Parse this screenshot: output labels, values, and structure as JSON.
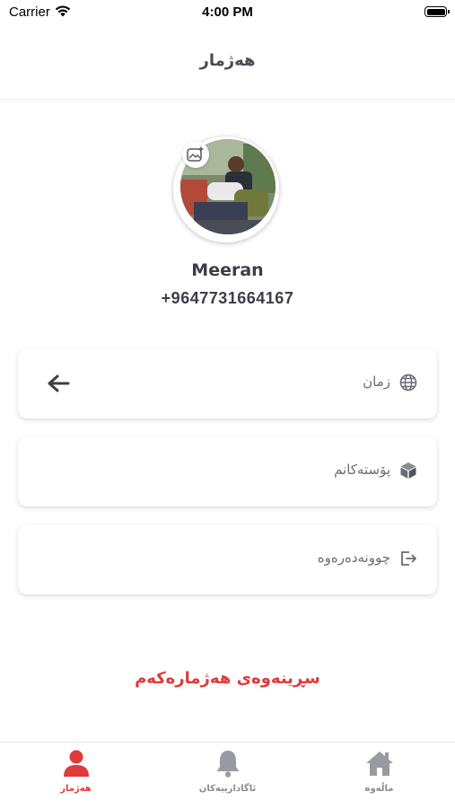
{
  "status_bar": {
    "carrier": "Carrier",
    "time": "4:00 PM"
  },
  "header": {
    "title": "هەژمار"
  },
  "profile": {
    "name": "Meeran",
    "phone": "+9647731664167"
  },
  "menu": [
    {
      "label": "زمان",
      "icon": "globe-icon"
    },
    {
      "label": "پۆستەکانم",
      "icon": "box-icon"
    },
    {
      "label": "چوونەدەرەوە",
      "icon": "logout-icon"
    }
  ],
  "delete_account": "سڕینەوەی هەژمارەکەم",
  "tabs": [
    {
      "label": "هەژمار",
      "icon": "user-icon",
      "active": true
    },
    {
      "label": "ئاگادارییەکان",
      "icon": "bell-icon",
      "active": false
    },
    {
      "label": "ماڵەوە",
      "icon": "home-icon",
      "active": false
    }
  ],
  "colors": {
    "accent": "#e03a3a",
    "icon_gray": "#9a9aa2",
    "text": "#3d3d48"
  }
}
